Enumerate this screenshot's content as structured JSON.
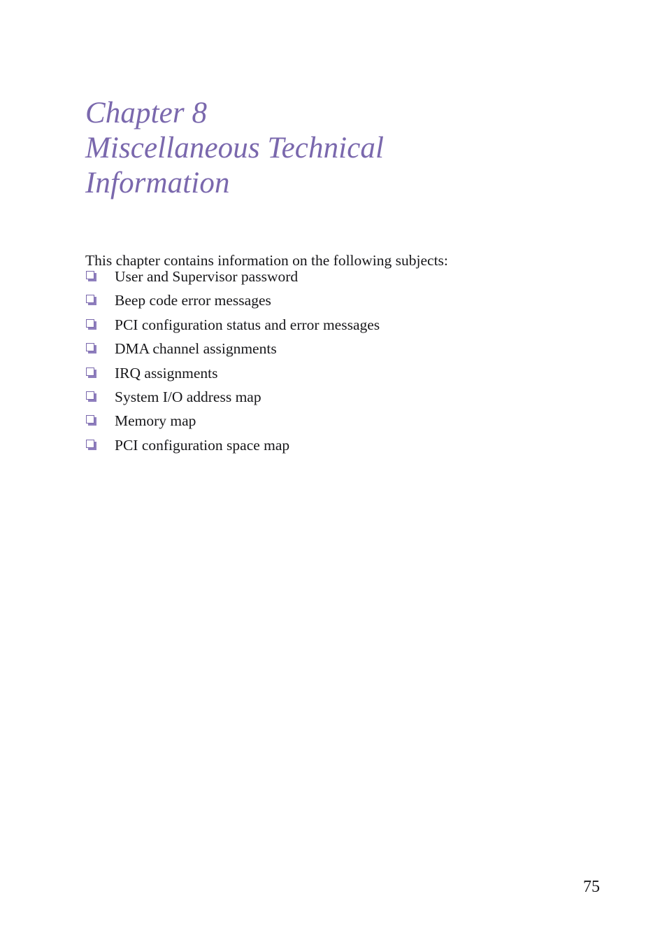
{
  "document": {
    "page_number": "75",
    "accent_color": "#7a68ad",
    "bullet_shadow_color": "#8f7fbe",
    "text_color": "#17171a",
    "background_color": "#ffffff"
  },
  "chapter": {
    "title_lines": [
      "Chapter 8",
      "Miscellaneous Technical",
      "Information"
    ],
    "number": "8",
    "name": "Miscellaneous Technical Information"
  },
  "body": {
    "intro": "This chapter contains information on the following subjects:",
    "subjects": [
      {
        "bullet_icon": "shadowed-square-bullet-icon",
        "label": "User and Supervisor password"
      },
      {
        "bullet_icon": "shadowed-square-bullet-icon",
        "label": "Beep code error messages"
      },
      {
        "bullet_icon": "shadowed-square-bullet-icon",
        "label": "PCI configuration status and error messages"
      },
      {
        "bullet_icon": "shadowed-square-bullet-icon",
        "label": "DMA channel assignments"
      },
      {
        "bullet_icon": "shadowed-square-bullet-icon",
        "label": "IRQ assignments"
      },
      {
        "bullet_icon": "shadowed-square-bullet-icon",
        "label": "System I/O address map"
      },
      {
        "bullet_icon": "shadowed-square-bullet-icon",
        "label": "Memory map"
      },
      {
        "bullet_icon": "shadowed-square-bullet-icon",
        "label": "PCI configuration space map"
      }
    ]
  }
}
